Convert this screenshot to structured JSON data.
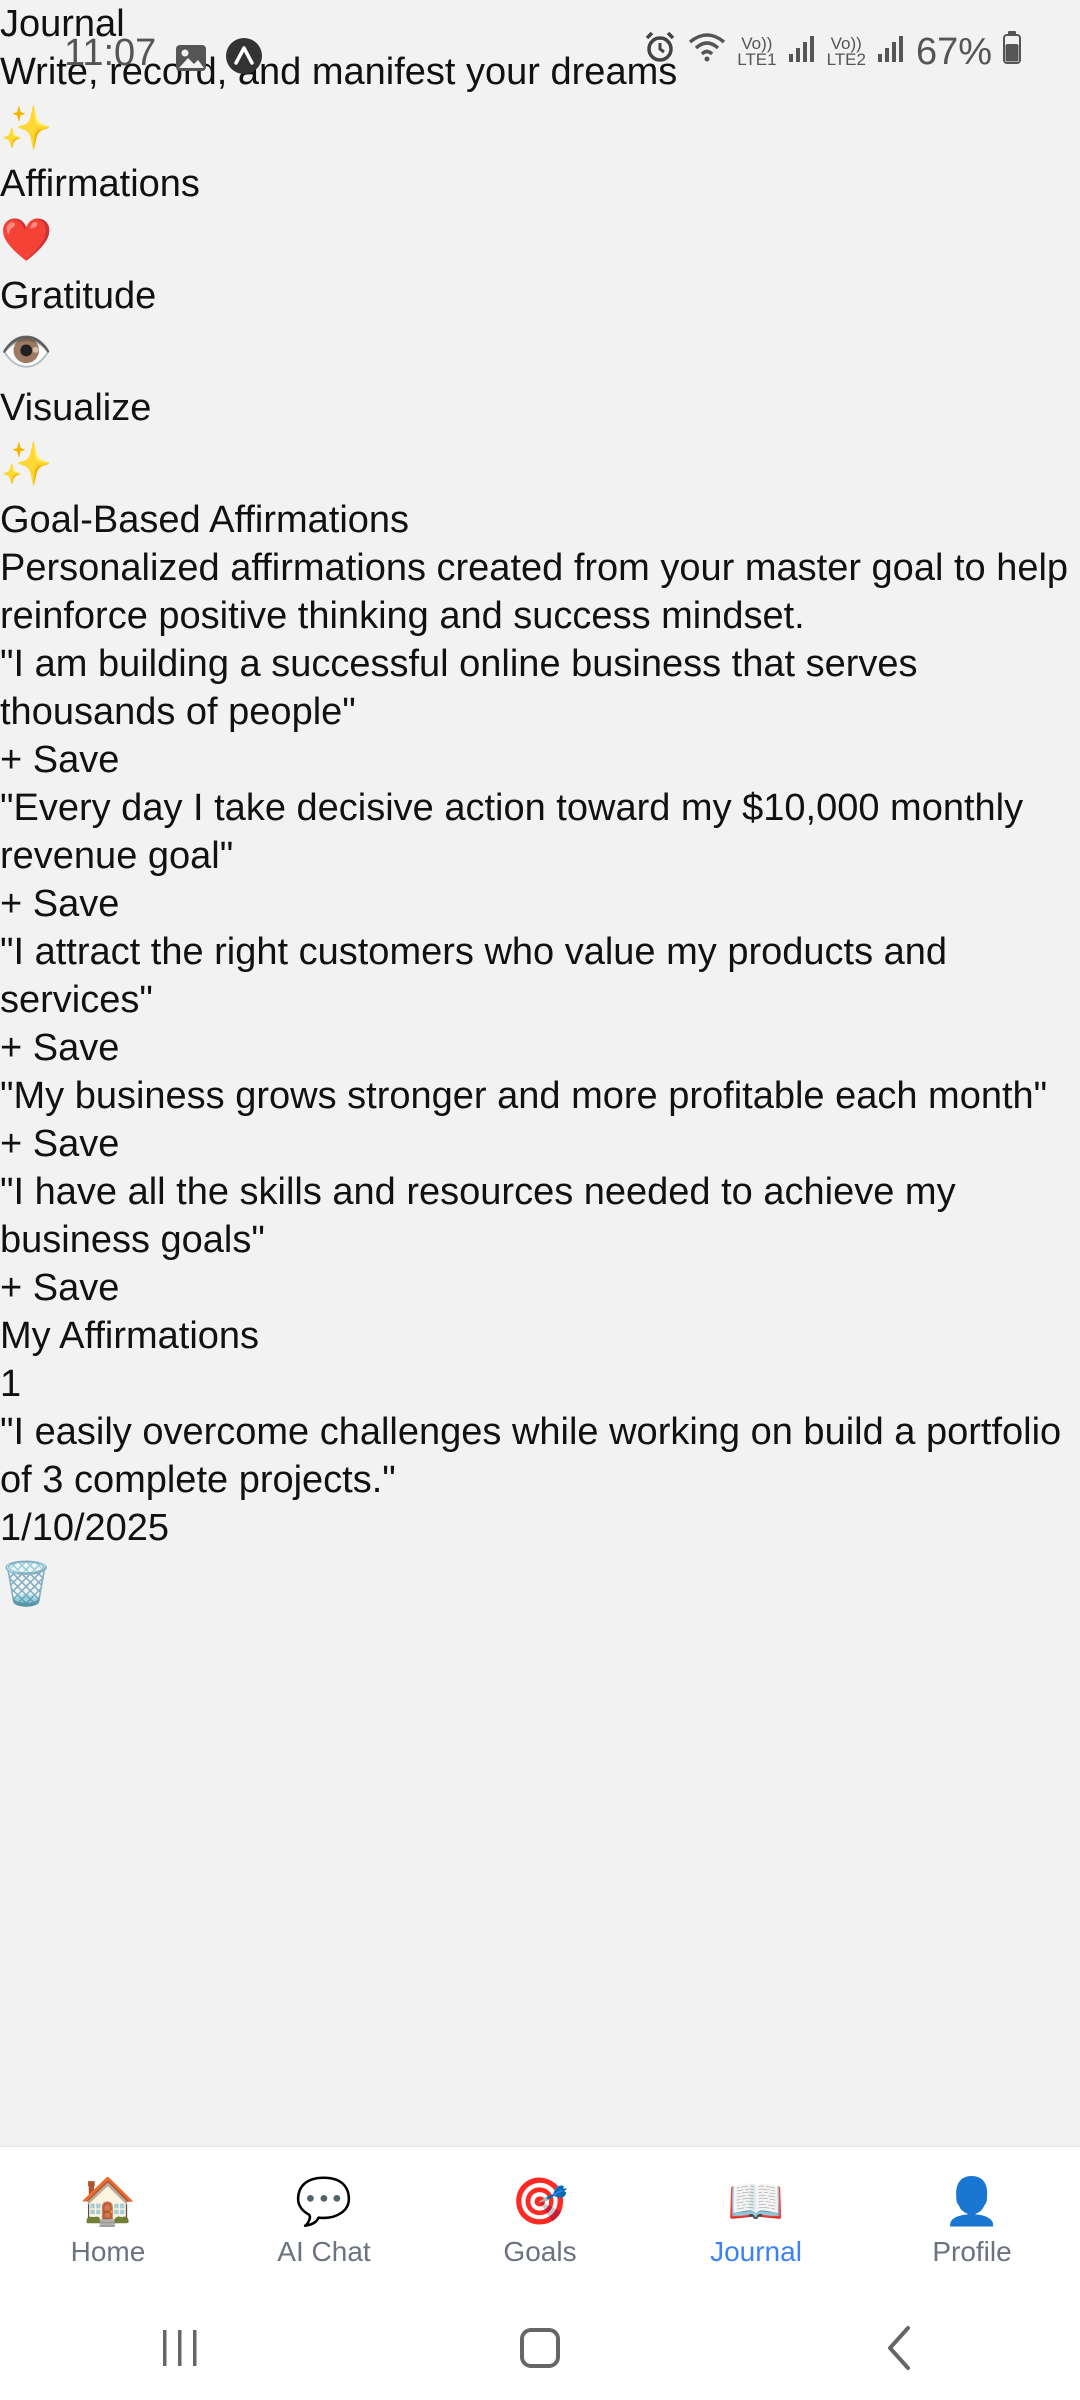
{
  "status_bar": {
    "time": "11:07",
    "battery": "67%",
    "lte1_label": "LTE1",
    "lte2_label": "LTE2",
    "volte_label": "Vo))"
  },
  "header": {
    "title": "Journal",
    "subtitle": "Write, record, and manifest your dreams"
  },
  "tabs": [
    {
      "emoji": "✨",
      "label": "Affirmations"
    },
    {
      "emoji": "❤️",
      "label": "Gratitude"
    },
    {
      "emoji": "👁️",
      "label": "Visualize"
    }
  ],
  "goal_section": {
    "emoji": "✨",
    "title": "Goal-Based Affirmations",
    "description": "Personalized affirmations created from your master goal to help reinforce positive thinking and success mindset.",
    "save_label": "+ Save",
    "affirmations": [
      "\"I am building a successful online business that serves thousands of people\"",
      "\"Every day I take decisive action toward my $10,000 monthly revenue goal\"",
      "\"I attract the right customers who value my products and services\"",
      "\"My business grows stronger and more profitable each month\"",
      "\"I have all the skills and resources needed to achieve my business goals\""
    ]
  },
  "my_affirmations": {
    "title": "My Affirmations",
    "count": "1",
    "items": [
      {
        "text": "\"I easily overcome challenges while working on build a portfolio of 3 complete projects.\"",
        "date": "1/10/2025",
        "delete_icon": "🗑️"
      }
    ]
  },
  "bottom_nav": [
    {
      "icon": "🏠",
      "label": "Home",
      "active": false
    },
    {
      "icon": "💬",
      "label": "AI Chat",
      "active": false
    },
    {
      "icon": "🎯",
      "label": "Goals",
      "active": false
    },
    {
      "icon": "📖",
      "label": "Journal",
      "active": true
    },
    {
      "icon": "👤",
      "label": "Profile",
      "active": false
    }
  ],
  "colors": {
    "background": "#f2f2f2",
    "active_nav": "#3b82f6",
    "inactive_nav": "#6b7280"
  }
}
